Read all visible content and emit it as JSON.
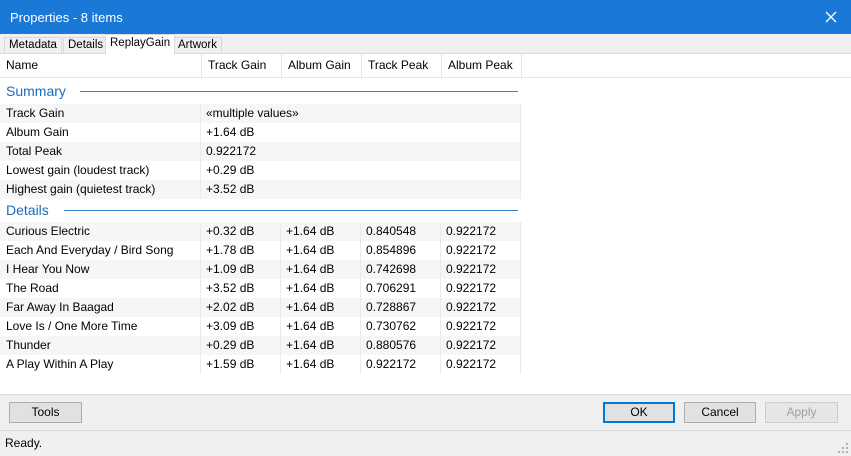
{
  "window": {
    "title": "Properties - 8 items",
    "close_icon": "close-icon"
  },
  "tabs": [
    {
      "label": "Metadata",
      "active": false
    },
    {
      "label": "Details",
      "active": false
    },
    {
      "label": "ReplayGain",
      "active": true
    },
    {
      "label": "Artwork",
      "active": false
    }
  ],
  "columns": [
    "Name",
    "Track Gain",
    "Album Gain",
    "Track Peak",
    "Album Peak"
  ],
  "summary": {
    "heading": "Summary",
    "rows": [
      {
        "name": "Track Gain",
        "value": "«multiple values»"
      },
      {
        "name": "Album Gain",
        "value": "+1.64 dB"
      },
      {
        "name": "Total Peak",
        "value": "0.922172"
      },
      {
        "name": "Lowest gain (loudest track)",
        "value": "+0.29 dB"
      },
      {
        "name": "Highest gain (quietest track)",
        "value": "+3.52 dB"
      }
    ]
  },
  "details": {
    "heading": "Details",
    "rows": [
      [
        "Curious Electric",
        "+0.32 dB",
        "+1.64 dB",
        "0.840548",
        "0.922172"
      ],
      [
        "Each And Everyday / Bird Song",
        "+1.78 dB",
        "+1.64 dB",
        "0.854896",
        "0.922172"
      ],
      [
        "I Hear You Now",
        "+1.09 dB",
        "+1.64 dB",
        "0.742698",
        "0.922172"
      ],
      [
        "The Road",
        "+3.52 dB",
        "+1.64 dB",
        "0.706291",
        "0.922172"
      ],
      [
        "Far Away In Baagad",
        "+2.02 dB",
        "+1.64 dB",
        "0.728867",
        "0.922172"
      ],
      [
        "Love Is / One More Time",
        "+3.09 dB",
        "+1.64 dB",
        "0.730762",
        "0.922172"
      ],
      [
        "Thunder",
        "+0.29 dB",
        "+1.64 dB",
        "0.880576",
        "0.922172"
      ],
      [
        "A Play Within A Play",
        "+1.59 dB",
        "+1.64 dB",
        "0.922172",
        "0.922172"
      ]
    ]
  },
  "buttons": {
    "tools": "Tools",
    "ok": "OK",
    "cancel": "Cancel",
    "apply": "Apply"
  },
  "status": {
    "text": "Ready."
  },
  "colors": {
    "titlebar": "#1a78d6",
    "section": "#1c6bbf",
    "focus": "#0078d7"
  }
}
